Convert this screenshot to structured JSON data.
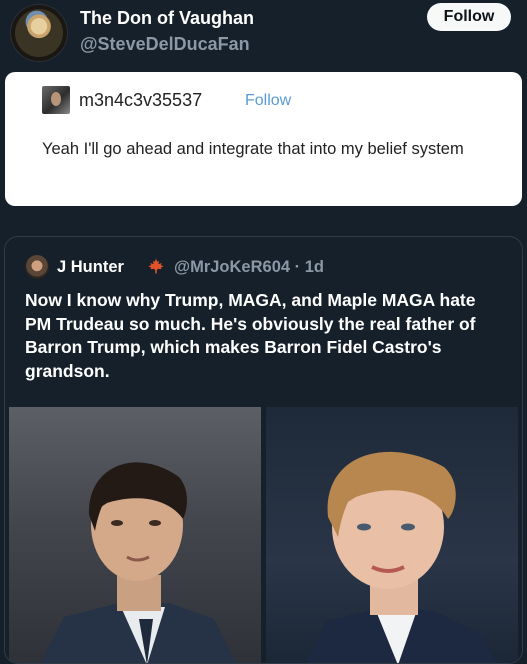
{
  "header": {
    "display_name": "The Don of Vaughan",
    "handle": "@SteveDelDucaFan",
    "follow_label": "Follow"
  },
  "quoted_post": {
    "username": "m3n4c3v35537",
    "follow_label": "Follow",
    "text": "Yeah I'll go ahead and integrate that into my belief system"
  },
  "quote_tweet": {
    "name": "J Hunter",
    "badge_icon": "maple-leaf-icon",
    "handle_time": "@MrJoKeR604 · 1d",
    "text": "Now I know why Trump, MAGA, and Maple MAGA hate PM Trudeau so much. He's obviously the real father of Barron Trump, which makes Barron Fidel Castro's grandson.",
    "images": [
      "photo-left",
      "photo-right"
    ]
  },
  "colors": {
    "background": "#15202b",
    "link_blue": "#5b9bd5",
    "muted": "#8b98a5",
    "maple_red": "#e0532a"
  }
}
